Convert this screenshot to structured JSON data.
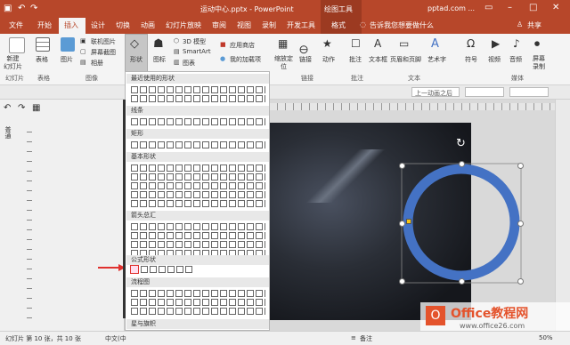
{
  "titlebar": {
    "title": "运动中心.pptx - PowerPoint",
    "tool_tab": "绘图工具",
    "account": "pptad.com ..."
  },
  "tabs": {
    "file": "文件",
    "home": "开始",
    "insert": "插入",
    "design": "设计",
    "transitions": "切换",
    "animations": "动画",
    "slideshow": "幻灯片放映",
    "review": "审阅",
    "view": "视图",
    "record": "录制",
    "developer": "开发工具",
    "format": "格式",
    "tell": "告诉我您想要做什么",
    "share": "共享"
  },
  "ribbon": {
    "new_slide": "新建\n幻灯片",
    "table": "表格",
    "pictures": "图片",
    "online_pictures": "联机图片",
    "screenshot": "屏幕截图",
    "album": "相册",
    "shapes": "形状",
    "icons": "图标",
    "model3d": "3D 模型",
    "smartart": "SmartArt",
    "chart": "图表",
    "store": "应用商店",
    "my_addins": "我的加载项",
    "zoom": "缩放定\n位",
    "link": "链接",
    "action": "动作",
    "comment": "批注",
    "textbox": "文本框",
    "header_footer": "页眉和页脚",
    "wordart": "艺术字",
    "symbol": "符号",
    "video": "视频",
    "audio": "音频",
    "screen_rec": "屏幕\n录制"
  },
  "groups": {
    "slides": "幻灯片",
    "tables": "表格",
    "images": "图像",
    "links": "链接",
    "comments": "批注",
    "text": "文本",
    "media": "媒体"
  },
  "anim": {
    "placeholder": "上一动画之后"
  },
  "leftpane": {
    "vertical_label": "普通"
  },
  "gallery": {
    "recent": "最近使用的形状",
    "lines": "线条",
    "rect": "矩形",
    "basic": "基本形状",
    "arrows": "箭头总汇",
    "equation": "公式形状",
    "flowchart": "流程图",
    "stars": "星与旗帜"
  },
  "status": {
    "slide_info": "幻灯片 第 10 张，共 10 张",
    "lang": "中文(中",
    "notes": "备注",
    "zoom": "50%"
  },
  "watermark": {
    "brand": "Office教程网",
    "url": "www.office26.com"
  },
  "colors": {
    "accent": "#b7472a",
    "ring": "#4472c4",
    "arrow": "#e0312e"
  }
}
